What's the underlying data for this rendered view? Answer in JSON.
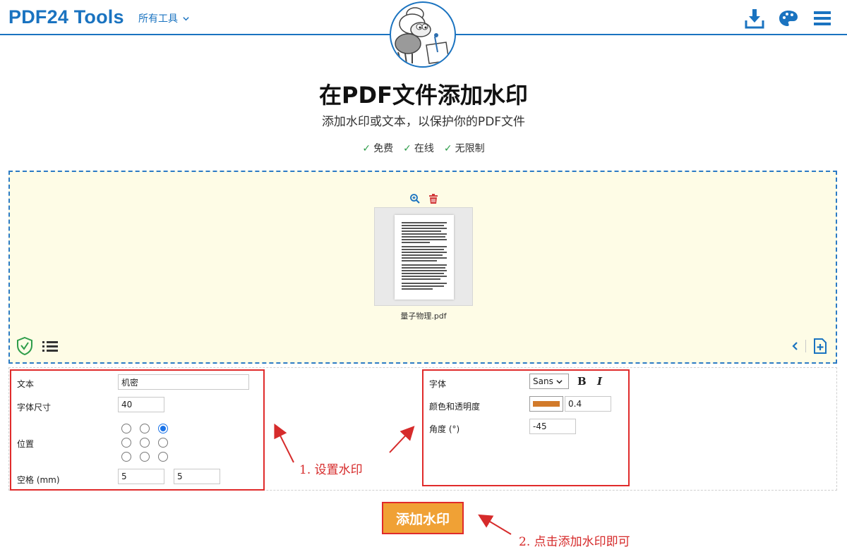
{
  "header": {
    "brand": "PDF24 Tools",
    "tools_menu_label": "所有工具",
    "icons": [
      "download-icon",
      "palette-icon",
      "menu-icon"
    ],
    "accent_color": "#1a73c0"
  },
  "hero": {
    "title": "在PDF文件添加水印",
    "subtitle": "添加水印或文本，以保护你的PDF文件",
    "features": [
      {
        "check": "✓",
        "label": "免费"
      },
      {
        "check": "✓",
        "label": "在线"
      },
      {
        "check": "✓",
        "label": "无限制"
      }
    ]
  },
  "dropzone": {
    "file_name": "量子物理.pdf",
    "background_color": "#fefce6",
    "icons": [
      "zoom-icon",
      "trash-icon",
      "shield-icon",
      "list-icon",
      "chevron-left-icon",
      "add-file-icon"
    ]
  },
  "settings_left": {
    "text_label": "文本",
    "text_value": "机密",
    "font_size_label": "字体尺寸",
    "font_size_value": "40",
    "position_label": "位置",
    "position_selected": "top-right",
    "spacing_label": "空格 (mm)",
    "spacing_x": "5",
    "spacing_y": "5"
  },
  "settings_right": {
    "font_label": "字体",
    "font_value": "Sans",
    "bold_label": "B",
    "italic_label": "I",
    "color_label": "颜色和透明度",
    "color_value": "#d27a2a",
    "opacity_value": "0.4",
    "angle_label": "角度 (°)",
    "angle_value": "-45"
  },
  "annotations": {
    "step1": "1. 设置水印",
    "step2": "2. 点击添加水印即可",
    "color": "#d62b2b"
  },
  "action": {
    "add_button_label": "添加水印",
    "button_color": "#f0a135"
  }
}
